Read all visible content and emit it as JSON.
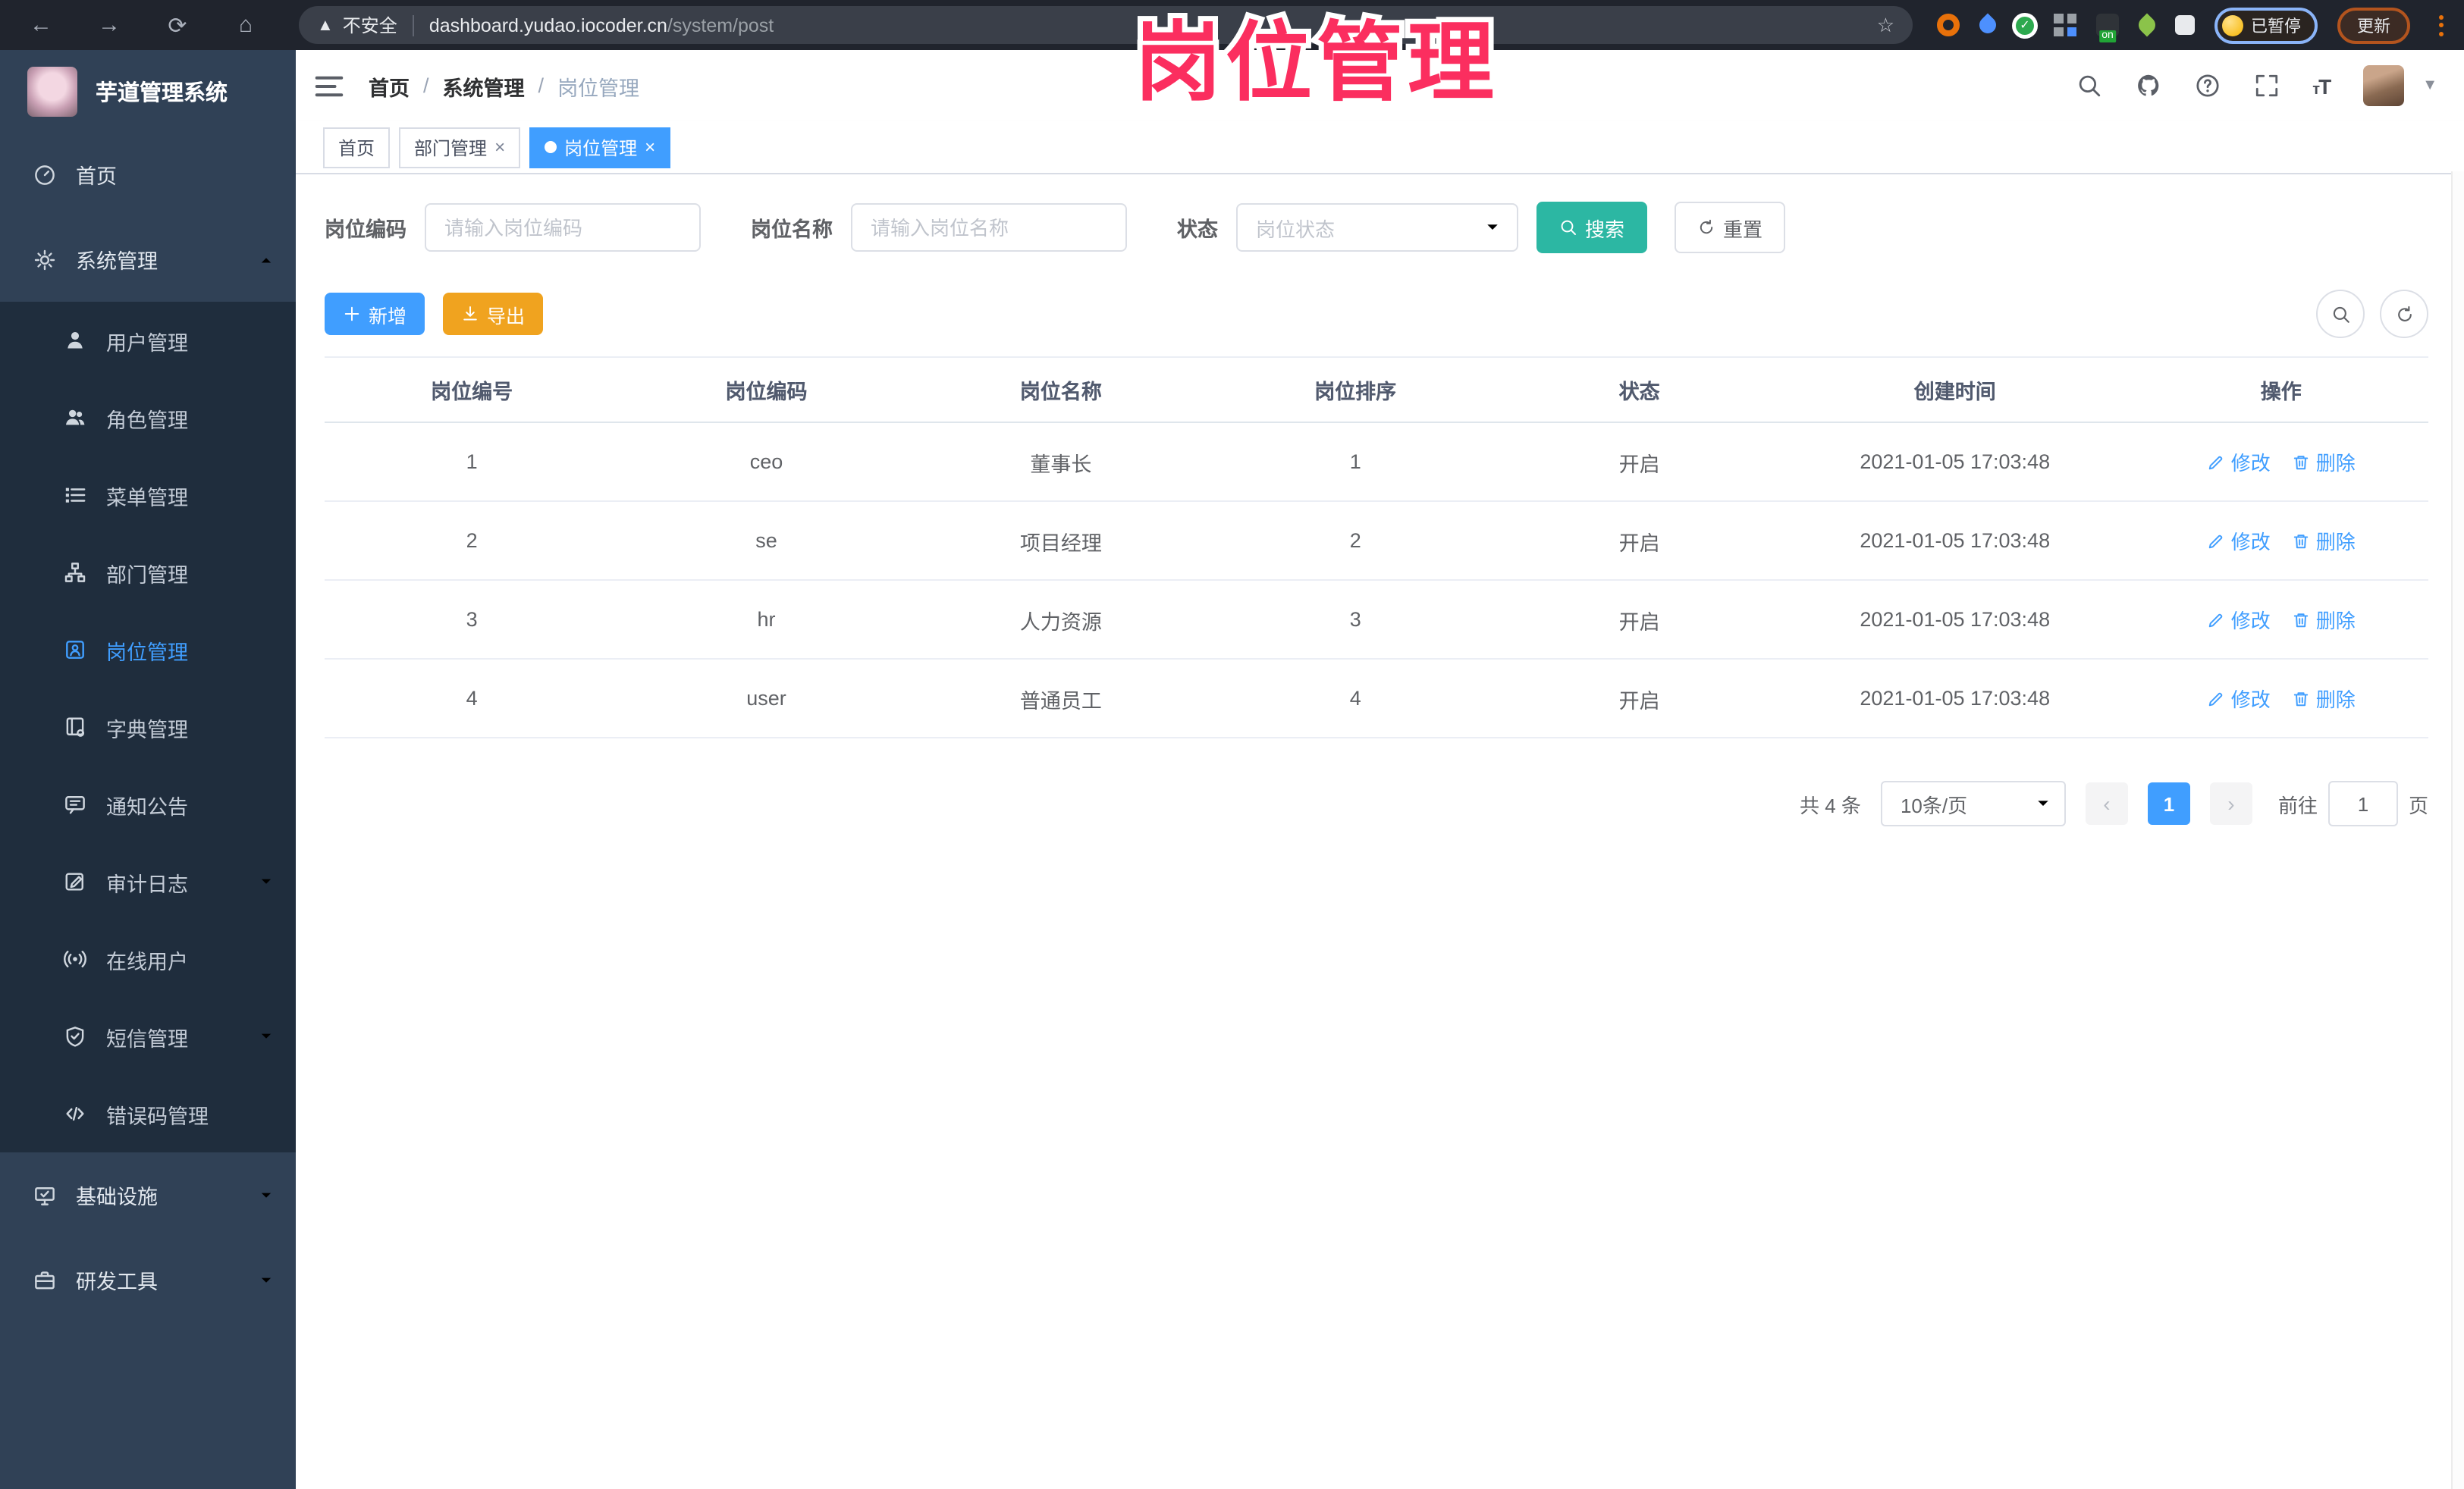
{
  "browser": {
    "security_label": "不安全",
    "url_host": "dashboard.yudao.iocoder.cn",
    "url_path": "/system/post",
    "on_badge": "on",
    "paused_badge": "已暂停",
    "update_label": "更新"
  },
  "watermark": "岗位管理",
  "sidebar": {
    "app_title": "芋道管理系统",
    "items": [
      {
        "label": "首页"
      },
      {
        "label": "系统管理"
      },
      {
        "label": "用户管理"
      },
      {
        "label": "角色管理"
      },
      {
        "label": "菜单管理"
      },
      {
        "label": "部门管理"
      },
      {
        "label": "岗位管理"
      },
      {
        "label": "字典管理"
      },
      {
        "label": "通知公告"
      },
      {
        "label": "审计日志"
      },
      {
        "label": "在线用户"
      },
      {
        "label": "短信管理"
      },
      {
        "label": "错误码管理"
      },
      {
        "label": "基础设施"
      },
      {
        "label": "研发工具"
      }
    ]
  },
  "navbar": {
    "breadcrumb": [
      "首页",
      "系统管理",
      "岗位管理"
    ]
  },
  "tags": [
    {
      "label": "首页"
    },
    {
      "label": "部门管理"
    },
    {
      "label": "岗位管理"
    }
  ],
  "filters": {
    "post_code_label": "岗位编码",
    "post_code_placeholder": "请输入岗位编码",
    "post_name_label": "岗位名称",
    "post_name_placeholder": "请输入岗位名称",
    "status_label": "状态",
    "status_placeholder": "岗位状态",
    "search_label": "搜索",
    "reset_label": "重置"
  },
  "toolbar": {
    "add_label": "新增",
    "export_label": "导出"
  },
  "table": {
    "columns": [
      "岗位编号",
      "岗位编码",
      "岗位名称",
      "岗位排序",
      "状态",
      "创建时间",
      "操作"
    ],
    "edit_label": "修改",
    "delete_label": "删除",
    "rows": [
      {
        "id": "1",
        "code": "ceo",
        "name": "董事长",
        "sort": "1",
        "status": "开启",
        "created": "2021-01-05 17:03:48"
      },
      {
        "id": "2",
        "code": "se",
        "name": "项目经理",
        "sort": "2",
        "status": "开启",
        "created": "2021-01-05 17:03:48"
      },
      {
        "id": "3",
        "code": "hr",
        "name": "人力资源",
        "sort": "3",
        "status": "开启",
        "created": "2021-01-05 17:03:48"
      },
      {
        "id": "4",
        "code": "user",
        "name": "普通员工",
        "sort": "4",
        "status": "开启",
        "created": "2021-01-05 17:03:48"
      }
    ]
  },
  "pagination": {
    "total": "共 4 条",
    "page_size": "10条/页",
    "current": "1",
    "goto_label": "前往",
    "goto_value": "1",
    "page_unit": "页"
  },
  "colors": {
    "accent": "#409eff",
    "search_teal": "#2cb7a3",
    "export_amber": "#f0a31f",
    "watermark_pink": "#fb2e5f",
    "sidebar_bg": "#304156",
    "submenu_bg": "#1f2d3d"
  }
}
